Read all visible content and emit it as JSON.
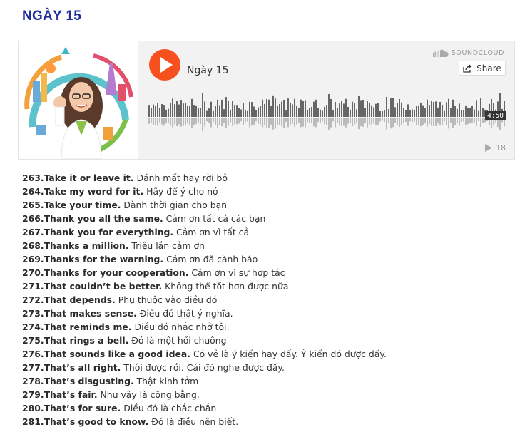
{
  "page": {
    "title": "NGÀY 15"
  },
  "player": {
    "track_title": "Ngày 15",
    "brand": "SOUNDCLOUD",
    "share_label": "Share",
    "duration": "4:50",
    "plays": "18",
    "accent_color": "#f5501d",
    "icons": [
      "play-icon",
      "soundcloud-cloud-icon",
      "share-icon",
      "plays-icon"
    ]
  },
  "phrases": [
    {
      "en": "263.Take it or leave it.",
      "vi": "Đánh mất hay rời bỏ"
    },
    {
      "en": "264.Take my word for it.",
      "vi": "Hãy để ý cho nó"
    },
    {
      "en": "265.Take your time.",
      "vi": "Dành thời gian cho bạn"
    },
    {
      "en": "266.Thank you all the same.",
      "vi": "Cảm ơn tất cả các bạn"
    },
    {
      "en": "267.Thank you for everything.",
      "vi": "Cảm ơn vì tất cả"
    },
    {
      "en": "268.Thanks a million.",
      "vi": "Triệu lần cảm ơn"
    },
    {
      "en": "269.Thanks for the warning.",
      "vi": "Cảm ơn đã cảnh báo"
    },
    {
      "en": "270.Thanks for your cooperation.",
      "vi": "Cảm ơn vì sự hợp tác"
    },
    {
      "en": "271.That couldn’t be better.",
      "vi": "Không thể tốt hơn được nữa"
    },
    {
      "en": "272.That depends.",
      "vi": "Phụ thuộc vào điều đó"
    },
    {
      "en": "273.That makes sense.",
      "vi": "Điều đó thật ý nghĩa."
    },
    {
      "en": "274.That reminds me.",
      "vi": "Điều đó nhắc nhở tôi."
    },
    {
      "en": "275.That rings a bell.",
      "vi": "Đó là một hồi chuông"
    },
    {
      "en": "276.That sounds like a good idea.",
      "vi": "Có vẻ là ý kiến hay đấy. Ý kiến đó được đấy."
    },
    {
      "en": "277.That’s all right.",
      "vi": "Thôi được rồi. Cái đó nghe được đấy."
    },
    {
      "en": "278.That’s disgusting.",
      "vi": "Thật kinh tởm"
    },
    {
      "en": "279.That’s fair.",
      "vi": "Như vậy là công bằng."
    },
    {
      "en": "280.That’s for sure.",
      "vi": "Điều đó là chắc chắn"
    },
    {
      "en": "281.That’s good to know.",
      "vi": "Đó là điều nên biết."
    }
  ]
}
